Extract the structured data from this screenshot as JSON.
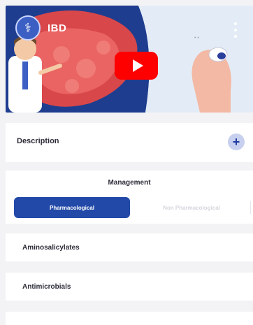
{
  "video": {
    "title": "IBD",
    "channel_icon": "stethoscope-icon",
    "play_button_color": "#ff0000",
    "menu_icon": "kebab-menu-icon"
  },
  "description": {
    "label": "Description",
    "expand_icon": "plus-icon",
    "expand_symbol": "+"
  },
  "management": {
    "title": "Management",
    "tabs": [
      {
        "label": "Pharmacological",
        "active": true
      },
      {
        "label": "Non Pharmacological",
        "active": false
      }
    ]
  },
  "items": [
    {
      "label": "Aminosalicylates"
    },
    {
      "label": "Antimicrobials"
    }
  ],
  "colors": {
    "accent": "#2249a8",
    "background": "#f3f3f6"
  }
}
